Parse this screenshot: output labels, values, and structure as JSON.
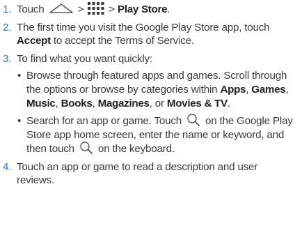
{
  "steps": [
    {
      "number": "1.",
      "parts": {
        "touch": "Touch",
        "sep1": " > ",
        "sep2": " > ",
        "play_store": "Play Store",
        "end": "."
      }
    },
    {
      "number": "2.",
      "line_a": "The first time you visit the Google Play Store app, touch ",
      "accept": "Accept",
      "line_b": " to accept the Terms of Service."
    },
    {
      "number": "3.",
      "intro": "To find what you want quickly:",
      "bullet1": {
        "text_a": "Browse through featured apps and games. Scroll through the options or browse by categories within ",
        "apps": "Apps",
        "c1": ", ",
        "games": "Games",
        "c2": ", ",
        "music": "Music",
        "c3": ", ",
        "books": "Books",
        "c4": ", ",
        "magazines": "Magazines",
        "or": ", or ",
        "movies": "Movies & TV",
        "end": "."
      },
      "bullet2": {
        "text_a": "Search for an app or game. Touch ",
        "text_b": " on the Google Play Store app home screen, enter the name or keyword, and then touch ",
        "text_c": " on the keyboard."
      }
    },
    {
      "number": "4.",
      "text": "Touch an app or game to read a description and user reviews."
    }
  ],
  "bullet_glyph": "•",
  "icons": {
    "home": "home-icon",
    "apps_grid": "apps-grid-icon",
    "search": "search-icon"
  },
  "colors": {
    "step_number": "#2a7ab8",
    "body_text": "#3a3a3a",
    "ui_term": "#222222",
    "icon_stroke": "#555555"
  }
}
